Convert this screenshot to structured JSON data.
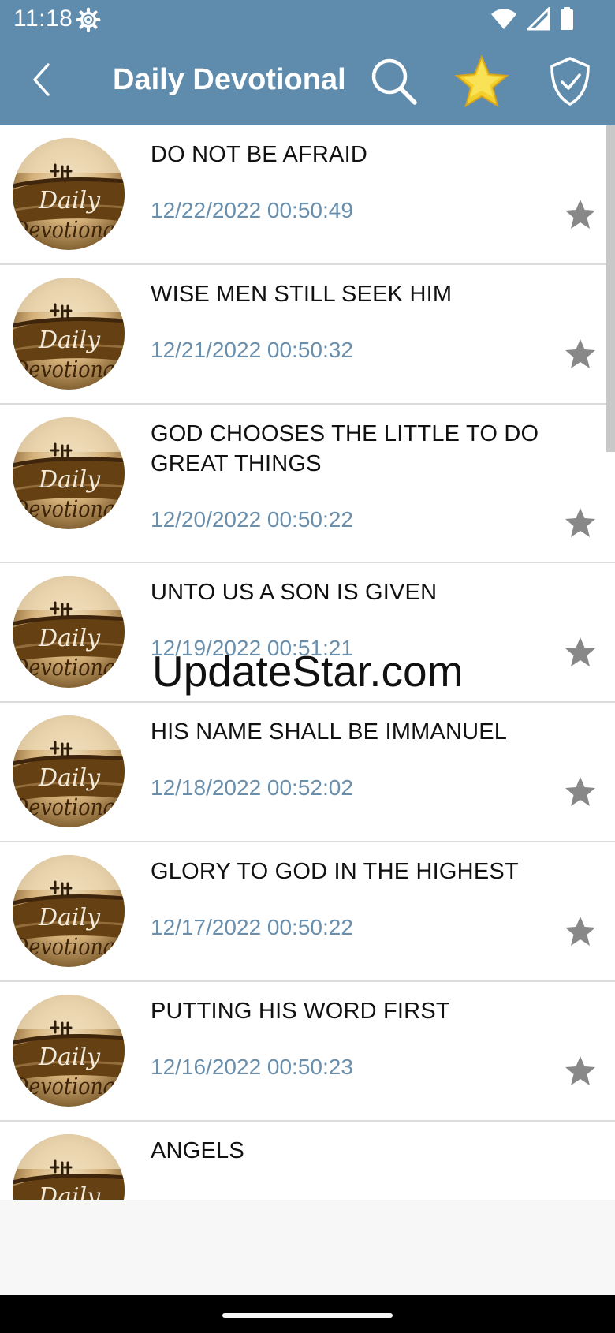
{
  "status_bar": {
    "time": "11:18",
    "icons": [
      "gear-icon",
      "wifi-icon",
      "signal-icon",
      "battery-icon"
    ]
  },
  "toolbar": {
    "title": "Daily Devotional",
    "back_icon": "chevron-left-icon",
    "search_icon": "search-icon",
    "favorites_icon": "star-icon",
    "shield_icon": "shield-check-icon"
  },
  "list": {
    "thumbnail_icon": "daily-devotional-logo",
    "thumbnail_text_line1": "Daily",
    "thumbnail_text_line2": "Devotional",
    "favorite_icon": "star-icon",
    "items": [
      {
        "title": "DO NOT BE AFRAID",
        "date": "12/22/2022 00:50:49"
      },
      {
        "title": "WISE MEN STILL SEEK HIM",
        "date": "12/21/2022 00:50:32"
      },
      {
        "title": "GOD CHOOSES THE LITTLE TO DO GREAT THINGS",
        "date": "12/20/2022 00:50:22"
      },
      {
        "title": "UNTO US A SON IS GIVEN",
        "date": "12/19/2022 00:51:21"
      },
      {
        "title": "HIS NAME SHALL BE IMMANUEL",
        "date": "12/18/2022 00:52:02"
      },
      {
        "title": "GLORY TO GOD IN THE HIGHEST",
        "date": "12/17/2022 00:50:22"
      },
      {
        "title": "PUTTING HIS WORD FIRST",
        "date": "12/16/2022 00:50:23"
      },
      {
        "title": "ANGELS",
        "date": ""
      }
    ]
  },
  "watermark": {
    "text": "UpdateStar.com"
  },
  "colors": {
    "toolbar_bg": "#5f8bad",
    "date_text": "#6a8fac",
    "star_grey": "#888888",
    "favorites_star": "#f3cf2b",
    "nav_bar": "#000000"
  }
}
